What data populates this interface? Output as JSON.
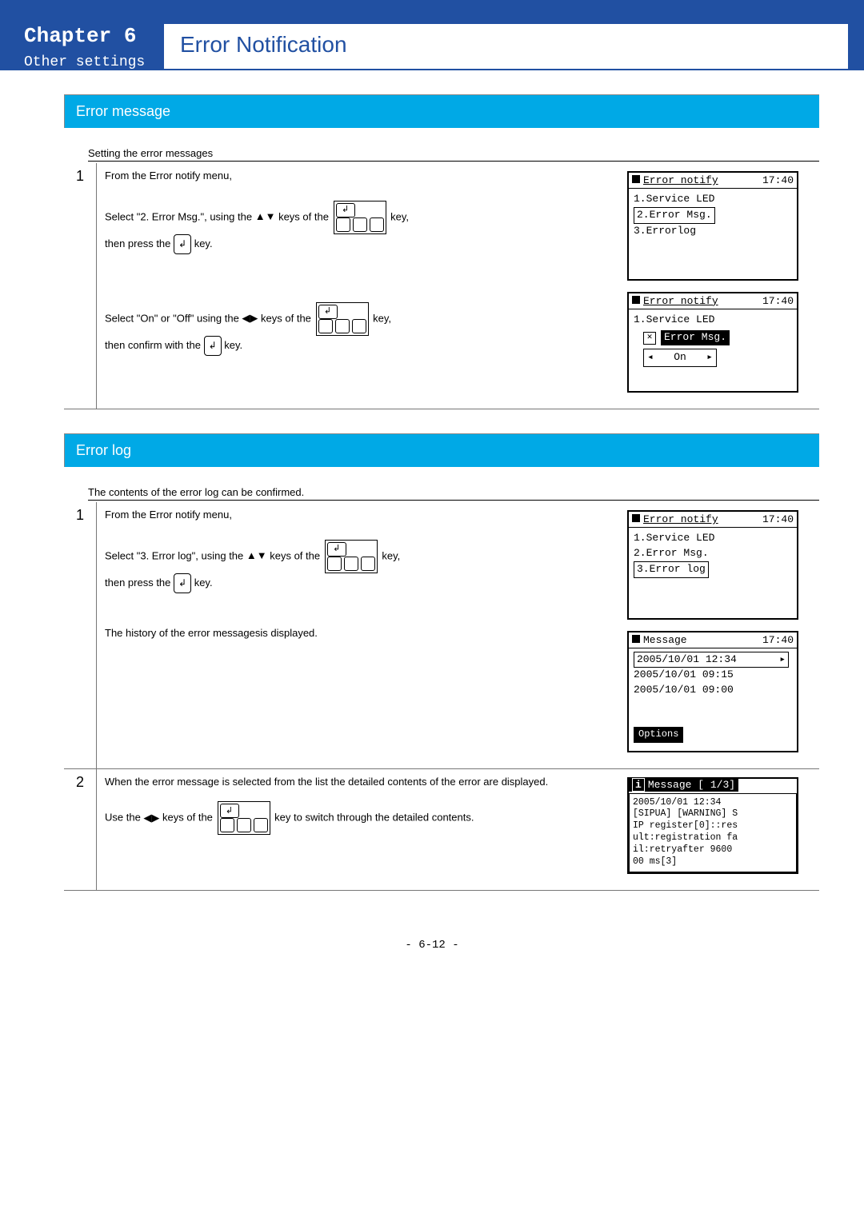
{
  "header": {
    "chapter": "Chapter 6",
    "subtitle": "Other settings",
    "page_title": "Error Notification"
  },
  "section1": {
    "heading": "Error message",
    "caption": "Setting the error messages",
    "step1_num": "1",
    "step1_line1": "From the Error notify menu,",
    "step1_line2a": "Select \"2. Error Msg.\", using the ",
    "step1_line2b": " keys of the ",
    "step1_line2c": " key,",
    "step1_line3a": "then press the ",
    "step1_line3b": " key.",
    "step1b_line1a": "Select \"On\" or \"Off\" using the ",
    "step1b_line1b": " keys of the ",
    "step1b_line1c": " key,",
    "step1b_line2a": "then confirm with the ",
    "step1b_line2b": "  key."
  },
  "lcd1a": {
    "title": "Error notify",
    "time": "17:40",
    "i1": "1.Service LED",
    "i2": "2.Error Msg.",
    "i3": "3.Errorlog"
  },
  "lcd1b": {
    "title": "Error notify",
    "time": "17:40",
    "i1": "1.Service LED",
    "popup": "Error Msg.",
    "onoff": "On"
  },
  "section2": {
    "heading": "Error log",
    "caption": "The contents of the error log can be confirmed.",
    "step1_num": "1",
    "step1_line1": "From the Error notify menu,",
    "step1_line2a": "Select \"3. Error log\", using the ",
    "step1_line2b": " keys of the ",
    "step1_line2c": " key,",
    "step1_line3a": "then press the ",
    "step1_line3b": " key.",
    "step1_line4": "The history of the error messagesis displayed.",
    "step2_num": "2",
    "step2_line1": "When the error message is selected from the list the detailed contents of the error are displayed.",
    "step2_line2a": "Use the ",
    "step2_line2b": " keys of the ",
    "step2_line2c": " key to switch through the detailed contents."
  },
  "lcd2a": {
    "title": "Error notify",
    "time": "17:40",
    "i1": "1.Service LED",
    "i2": "2.Error Msg.",
    "i3": "3.Error log"
  },
  "lcd2b": {
    "title": "Message",
    "time": "17:40",
    "r1": "2005/10/01 12:34 ",
    "r2": "2005/10/01 09:15",
    "r3": "2005/10/01 09:00",
    "opt": "Options"
  },
  "lcd2c": {
    "title": "Message",
    "page": "[ 1/3]",
    "body": "2005/10/01 12:34\n[SIPUA] [WARNING] S\nIP register[0]::res\nult:registration fa\nil:retryafter 9600\n00 ms[3]"
  },
  "footer": "- 6-12 -"
}
